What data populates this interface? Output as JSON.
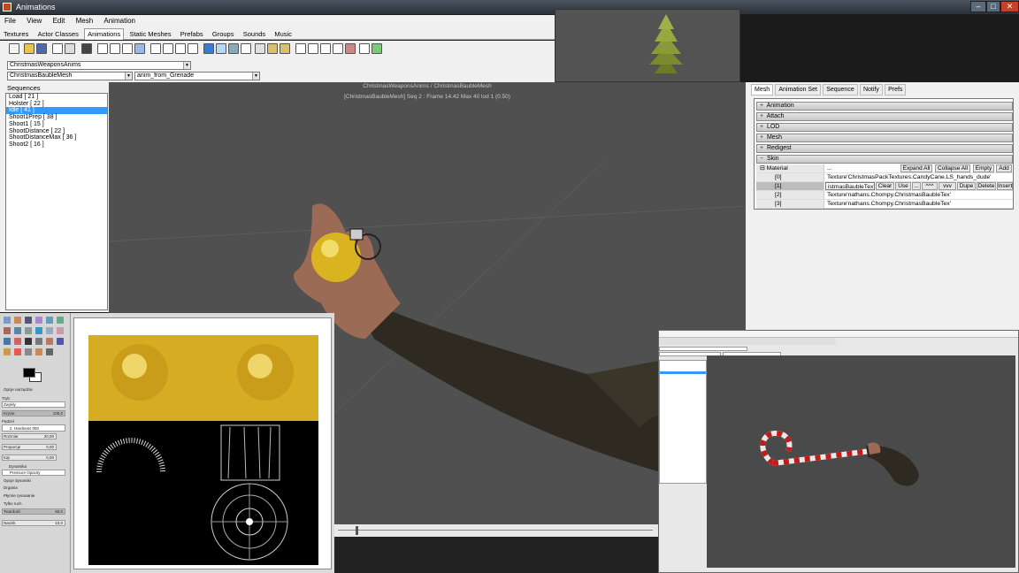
{
  "window": {
    "title": "Animations",
    "minimize": "–",
    "maximize": "□",
    "close": "✕"
  },
  "menu": [
    "File",
    "View",
    "Edit",
    "Mesh",
    "Animation"
  ],
  "tabs": [
    "Textures",
    "Actor Classes",
    "Animations",
    "Static Meshes",
    "Prefabs",
    "Groups",
    "Sounds",
    "Music"
  ],
  "active_tab": "Animations",
  "package_combo": "ChristmasWeaponsAnims",
  "mesh_combo": "ChristmasBaubleMesh",
  "anim_combo": "anim_from_Grenade",
  "sequences": {
    "title": "Sequences",
    "items": [
      "Load [ 21 ]",
      "Holster [ 22 ]",
      "Idle [ 41 ]",
      "Shoot1Prep [ 38 ]",
      "Shoot1 [ 15 ]",
      "ShootDistance [ 22 ]",
      "ShootDistanceMax [ 36 ]",
      "Shoot2 [ 16 ]"
    ],
    "selected_index": 2
  },
  "viewport": {
    "line1": "ChristmasWeaponsAnims / ChristmasBaubleMesh",
    "line2": "[ChristmasBaubleMesh]  Seq 2 : Frame 14.42  Max 40  lod 1 (0.50)"
  },
  "right_tabs": [
    "Mesh",
    "Animation Set",
    "Sequence",
    "Notify",
    "Prefs"
  ],
  "active_right_tab": "Mesh",
  "categories": [
    {
      "label": "Animation",
      "expander": "+"
    },
    {
      "label": "Attach",
      "expander": "+"
    },
    {
      "label": "LOD",
      "expander": "+"
    },
    {
      "label": "Mesh",
      "expander": "+"
    },
    {
      "label": "Redigest",
      "expander": "+"
    },
    {
      "label": "Skin",
      "expander": "−"
    }
  ],
  "material": {
    "label": "Material",
    "expander": "⊟",
    "value": "...",
    "buttons": [
      "Expand All",
      "Collapse All",
      "Empty",
      "Add"
    ],
    "rows": [
      {
        "index": "[0]",
        "value": "Texture'ChristmasPackTextures.CandyCane.LS_hands_dude'"
      },
      {
        "index": "[1]",
        "value": "istmasBaubleTex'"
      },
      {
        "index": "[2]",
        "value": "Texture'nathans.Chompy.ChristmasBaubleTex'"
      },
      {
        "index": "[3]",
        "value": "Texture'nathans.Chompy.ChristmasBaubleTex'"
      }
    ],
    "row_buttons": [
      "Clear",
      "Use",
      "...",
      "^^^",
      "vvv",
      "Dupe",
      "Delete",
      "Insert"
    ],
    "selected_row": 1
  },
  "paint": {
    "options_label": "Opcje narzędzia",
    "mode_label": "Tryb",
    "mode_value": "Zwykły",
    "opacity_label": "Krycie",
    "opacity_value": "100,0",
    "brush_label": "Pędzel",
    "brush_value": "2. Hardness 050",
    "size_label": "Rozmiar",
    "size_value": "20,00",
    "aspect_label": "Proporcje",
    "aspect_value": "0,00",
    "angle_label": "Kąt",
    "angle_value": "0,00",
    "dynamics_label": "Dynamika",
    "dynamics_value": "Pressure Opacity",
    "dyn_options_label": "Opcje dynamiki",
    "jitter_label": "Drgania",
    "smooth_label": "Płynne rysowanie",
    "incremental_label": "Tylko ruch",
    "hardness_label": "Twardość",
    "hardness_value": "50,0",
    "force_label": "Nacisk",
    "force_value": "10,0"
  },
  "colors": {
    "viewport": "#505050",
    "selection": "#3399ff",
    "close_button": "#c4412c"
  }
}
